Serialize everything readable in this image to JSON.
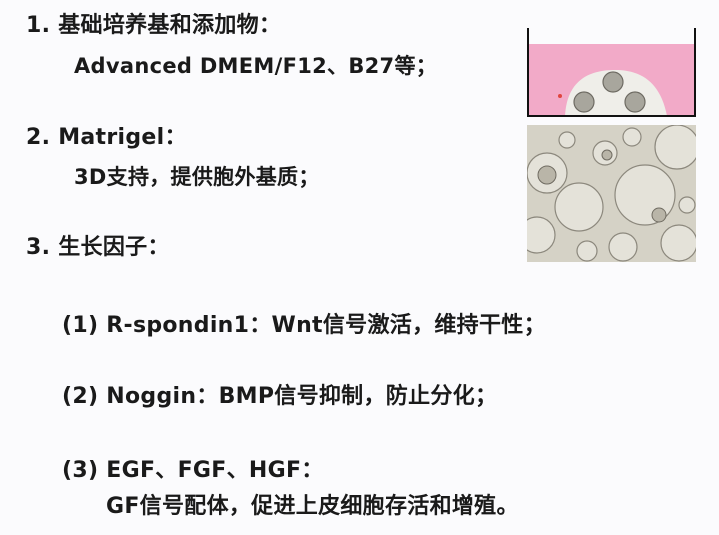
{
  "section1": {
    "heading": "1. 基础培养基和添加物：",
    "detail": "Advanced DMEM/F12、B27等；"
  },
  "section2": {
    "heading": "2. Matrigel：",
    "detail": "3D支持，提供胞外基质；"
  },
  "section3": {
    "heading": "3. 生长因子：",
    "items": [
      {
        "label": "(1) R-spondin1：Wnt信号激活，维持干性；"
      },
      {
        "label": "(2) Noggin：BMP信号抑制，防止分化；"
      },
      {
        "label": "(3) EGF、FGF、HGF：",
        "detail": "GF信号配体，促进上皮细胞存活和增殖。"
      }
    ]
  },
  "colors": {
    "text": "#1a1a1a",
    "dish_medium": "#f2aac8",
    "matrigel_dome": "#efeee9",
    "organoid": "#a8a69d",
    "micro_background": "#d5d2c6"
  }
}
